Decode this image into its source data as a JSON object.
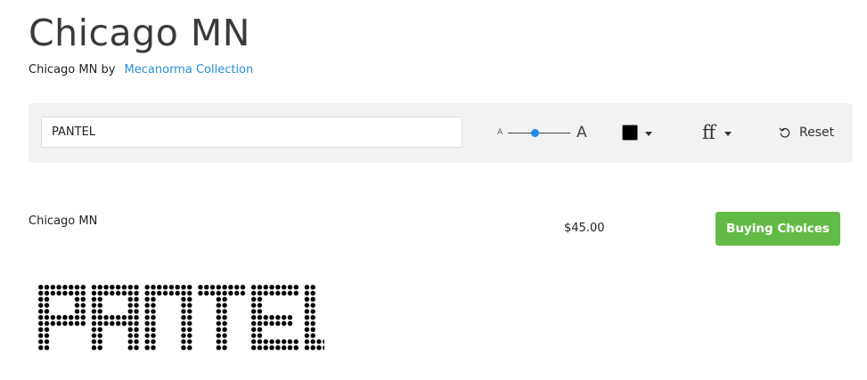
{
  "font": {
    "title": "Chicago MN",
    "byline_prefix": "Chicago MN by",
    "foundry_link": "Mecanorma Collection"
  },
  "toolbar": {
    "preview_text": "PANTEL",
    "size_small_label": "A",
    "size_large_label": "A",
    "size_slider_level": 0.43,
    "color_value": "#000000",
    "font_options_icon": "ff",
    "reset_label": "Reset",
    "reset_icon": "rotate-ccw-icon"
  },
  "product": {
    "name": "Chicago MN",
    "price": "$45.00",
    "buy_label": "Buying Choices"
  },
  "sample": {
    "text": "PANTEL",
    "color": "#000000"
  },
  "colors": {
    "accent_link": "#2a8fd8",
    "buy_green": "#62bb46",
    "slider_blue": "#1e8bec",
    "toolbar_bg": "#f2f2f2"
  }
}
